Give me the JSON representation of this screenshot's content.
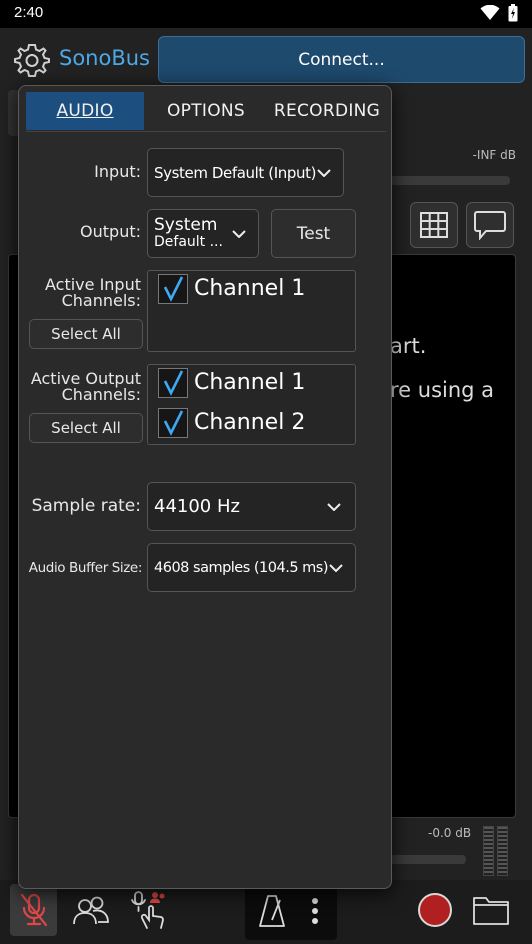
{
  "status_bar": {
    "time": "2:40"
  },
  "app": {
    "name": "SonoBus",
    "connect_label": "Connect...",
    "level_top": "-INF dB",
    "level_bottom": "-0.0 dB",
    "main_text_line1": "art.",
    "main_text_line2": "re using a"
  },
  "settings": {
    "tabs": [
      {
        "label": "AUDIO",
        "active": true
      },
      {
        "label": "OPTIONS",
        "active": false
      },
      {
        "label": "RECORDING",
        "active": false
      }
    ],
    "input": {
      "label": "Input:",
      "value": "System Default (Input)"
    },
    "output": {
      "label": "Output:",
      "value_line1": "System",
      "value_line2": "Default ...",
      "test_label": "Test"
    },
    "active_input": {
      "label_line1": "Active Input",
      "label_line2": "Channels:",
      "select_all_label": "Select All",
      "channels": [
        {
          "name": "Channel 1",
          "checked": true
        }
      ]
    },
    "active_output": {
      "label_line1": "Active Output",
      "label_line2": "Channels:",
      "select_all_label": "Select All",
      "channels": [
        {
          "name": "Channel 1",
          "checked": true
        },
        {
          "name": "Channel 2",
          "checked": true
        }
      ]
    },
    "sample_rate": {
      "label": "Sample rate:",
      "value": "44100 Hz"
    },
    "buffer_size": {
      "label": "Audio Buffer Size:",
      "value": "4608 samples (104.5 ms)"
    }
  },
  "colors": {
    "brand": "#4da8e8",
    "active_tab": "#1d4e80",
    "connect_bg": "#1e4a6e",
    "check": "#3fa9f5",
    "mic_muted": "#e04848",
    "record": "#b02020"
  },
  "icons": {
    "settings": "gear-icon",
    "layout": "grid-icon",
    "chat": "chat-bubble-icon",
    "mic": "mic-muted-icon",
    "peers": "people-icon",
    "speak": "mic-hand-icon",
    "metronome": "metronome-icon",
    "more": "more-vertical-icon",
    "record": "record-icon",
    "files": "folder-icon"
  }
}
